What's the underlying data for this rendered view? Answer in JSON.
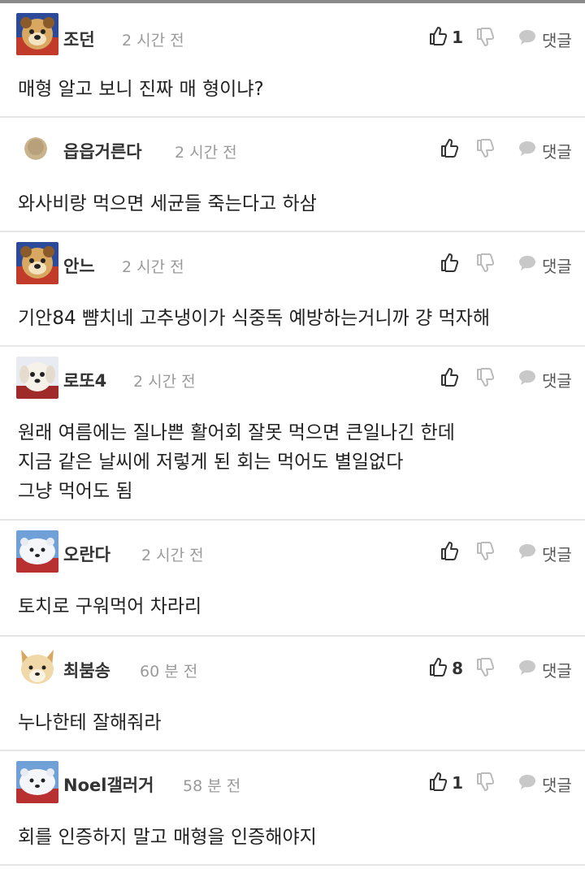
{
  "comments": [
    {
      "user": "조던",
      "time": "2 시간 전",
      "likes": "1",
      "reply": "댓글",
      "lines": [
        "매형 알고 보니 진짜 매 형이냐?"
      ],
      "avatar_icon": "dog-avatar-icon"
    },
    {
      "user": "읍읍거른다",
      "time": "2 시간 전",
      "likes": "",
      "reply": "댓글",
      "lines": [
        "와사비랑 먹으면 세균들 죽는다고 하삼"
      ],
      "avatar_icon": "round-avatar-icon"
    },
    {
      "user": "안느",
      "time": "2 시간 전",
      "likes": "",
      "reply": "댓글",
      "lines": [
        "기안84 뺨치네 고추냉이가 식중독 예방하는거니까 걍 먹자해"
      ],
      "avatar_icon": "dog-avatar-icon"
    },
    {
      "user": "로또4",
      "time": "2 시간 전",
      "likes": "",
      "reply": "댓글",
      "lines": [
        "원래 여름에는 질나쁜 활어회 잘못 먹으면 큰일나긴 한데",
        "지금 같은 날씨에 저렇게 된 회는 먹어도 별일없다",
        "그냥 먹어도 됨"
      ],
      "avatar_icon": "white-dog-avatar-icon"
    },
    {
      "user": "오란다",
      "time": "2 시간 전",
      "likes": "",
      "reply": "댓글",
      "lines": [
        "토치로 구워먹어 차라리"
      ],
      "avatar_icon": "polar-bear-avatar-icon"
    },
    {
      "user": "최붐송",
      "time": "60 분 전",
      "likes": "8",
      "reply": "댓글",
      "lines": [
        "누나한테 잘해줘라"
      ],
      "avatar_icon": "shiba-avatar-icon"
    },
    {
      "user": "Noel갤러거",
      "time": "58 분 전",
      "likes": "1",
      "reply": "댓글",
      "lines": [
        "회를 인증하지 말고 매형을 인증해야지"
      ],
      "avatar_icon": "polar-bear-avatar-icon"
    }
  ]
}
